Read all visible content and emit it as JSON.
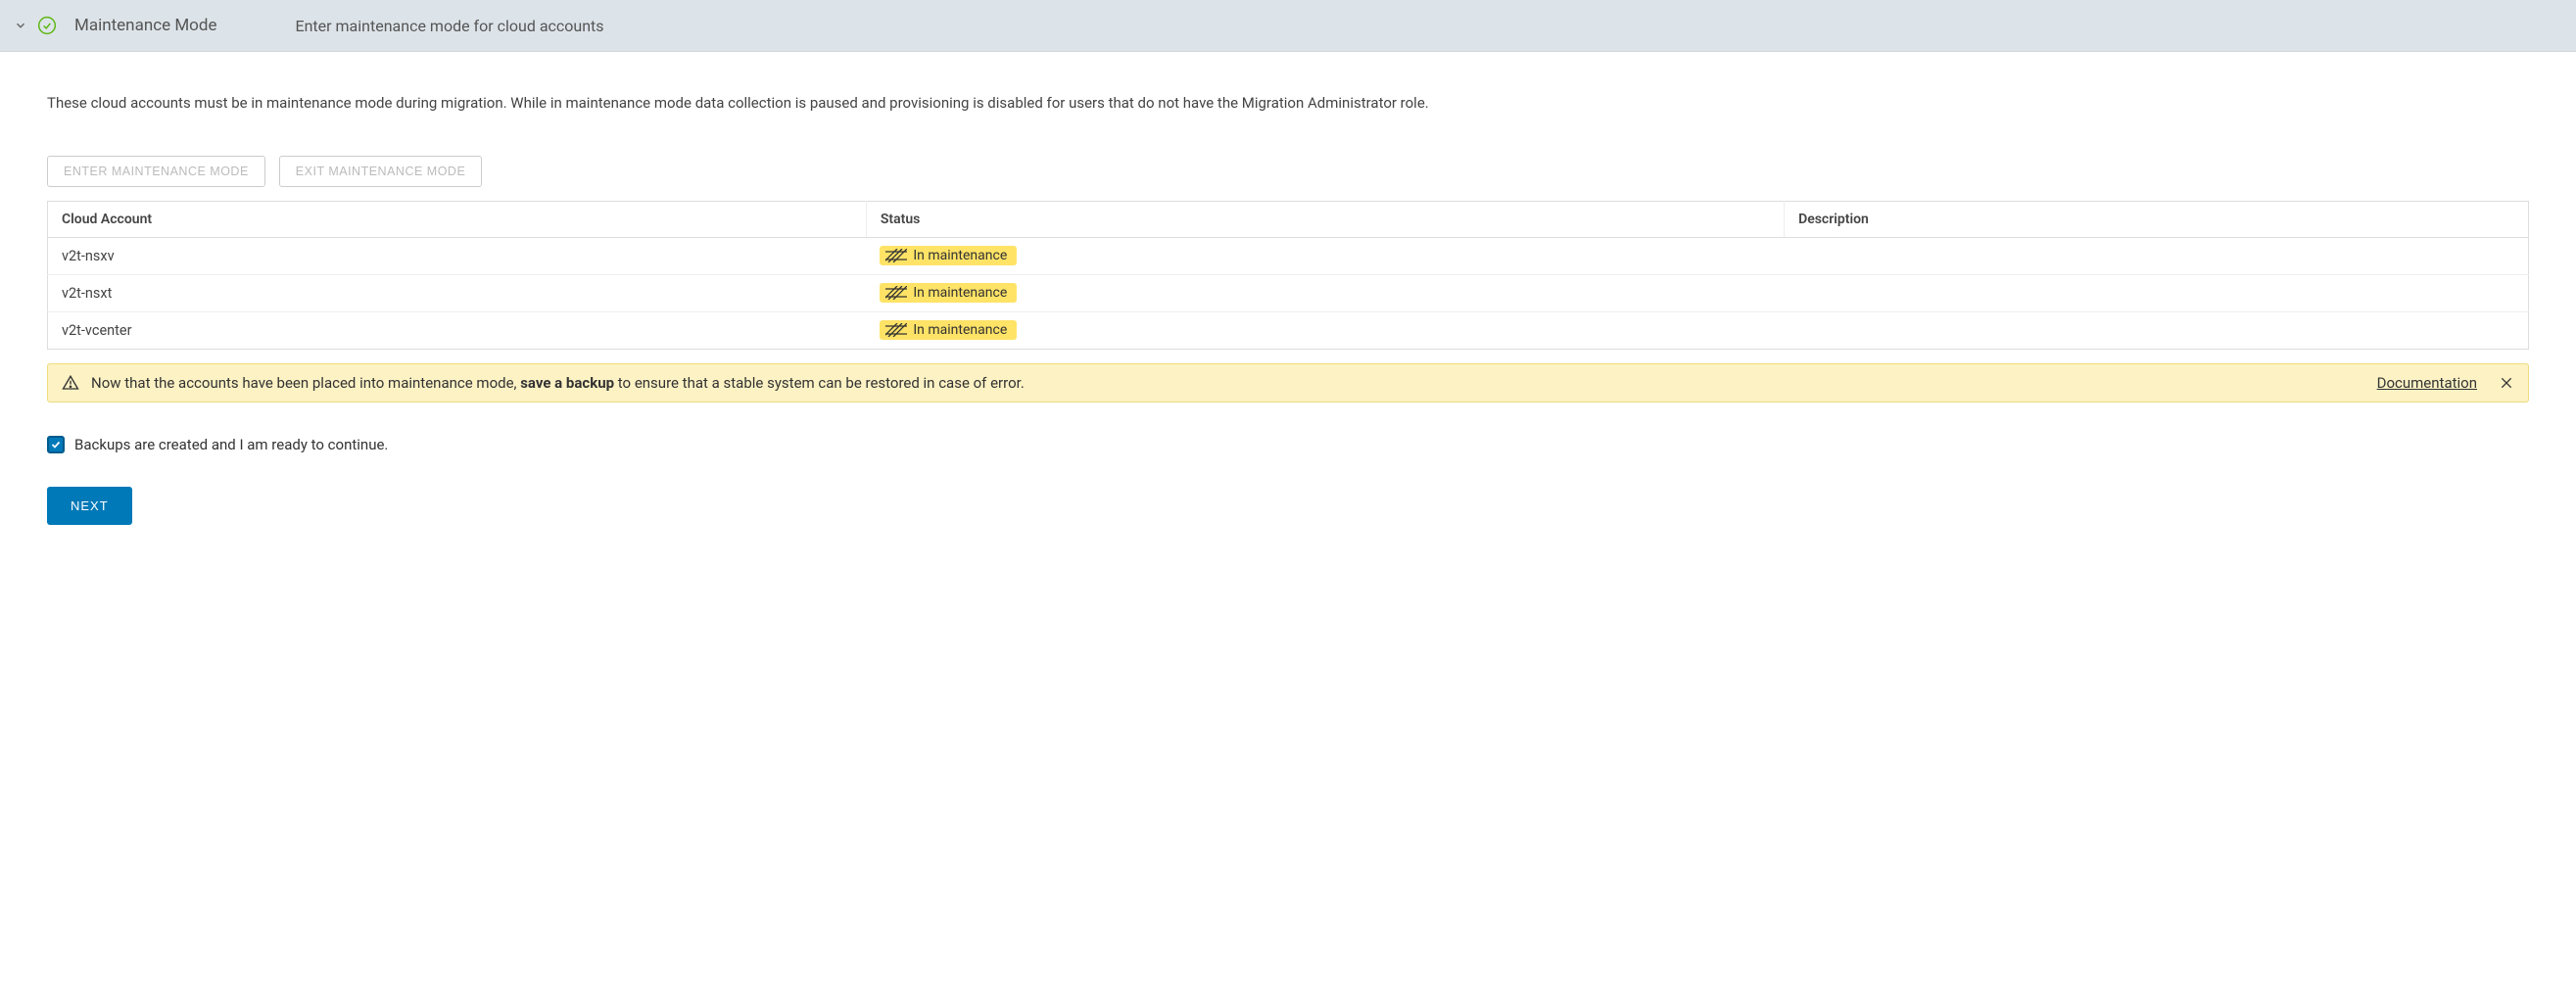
{
  "header": {
    "title": "Maintenance Mode",
    "subtitle": "Enter maintenance mode for cloud accounts"
  },
  "description": "These cloud accounts must be in maintenance mode during migration. While in maintenance mode data collection is paused and provisioning is disabled for users that do not have the Migration Administrator role.",
  "buttons": {
    "enter": "ENTER MAINTENANCE MODE",
    "exit": "EXIT MAINTENANCE MODE",
    "next": "NEXT"
  },
  "table": {
    "headers": {
      "account": "Cloud Account",
      "status": "Status",
      "description": "Description"
    },
    "rows": [
      {
        "account": "v2t-nsxv",
        "status": "In maintenance",
        "description": ""
      },
      {
        "account": "v2t-nsxt",
        "status": "In maintenance",
        "description": ""
      },
      {
        "account": "v2t-vcenter",
        "status": "In maintenance",
        "description": ""
      }
    ]
  },
  "alert": {
    "text_prefix": "Now that the accounts have been placed into maintenance mode, ",
    "text_bold": "save a backup",
    "text_suffix": " to ensure that a stable system can be restored in case of error.",
    "link": "Documentation"
  },
  "checkbox": {
    "label": "Backups are created and I am ready to continue.",
    "checked": true
  }
}
